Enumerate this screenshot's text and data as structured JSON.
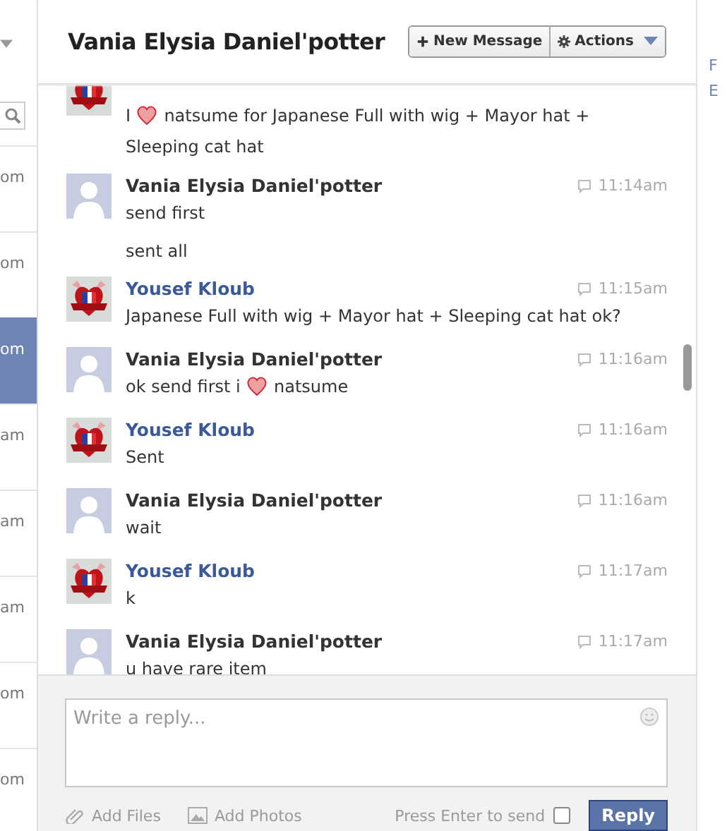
{
  "sidebar": {
    "items": [
      {
        "label": "om",
        "selected": false
      },
      {
        "label": "om",
        "selected": false
      },
      {
        "label": "om",
        "selected": true
      },
      {
        "label": "am",
        "selected": false
      },
      {
        "label": "am",
        "selected": false
      },
      {
        "label": "am",
        "selected": false
      },
      {
        "label": "om",
        "selected": false
      },
      {
        "label": "om",
        "selected": false
      }
    ]
  },
  "header": {
    "title": "Vania Elysia Daniel'potter",
    "buttons": [
      {
        "kind": "new",
        "label": "New Message"
      },
      {
        "kind": "actions",
        "label": "Actions"
      }
    ]
  },
  "messages": [
    {
      "kind": "me",
      "partial": true,
      "lines": [
        [
          {
            "kind": "text",
            "text": "I"
          },
          {
            "kind": "heart"
          },
          {
            "kind": "text",
            "text": "natsume for Japanese Full with wig + Mayor hat + Sleeping cat hat"
          }
        ]
      ]
    },
    {
      "kind": "them",
      "sender": "Vania Elysia Daniel'potter",
      "time": "11:14am",
      "lines": [
        [
          {
            "kind": "text",
            "text": "send first"
          }
        ],
        [
          {
            "kind": "text",
            "text": "sent all"
          }
        ]
      ]
    },
    {
      "kind": "me",
      "sender": "Yousef Kloub",
      "time": "11:15am",
      "lines": [
        [
          {
            "kind": "text",
            "text": "Japanese Full with wig + Mayor hat + Sleeping cat hat ok?"
          }
        ]
      ]
    },
    {
      "kind": "them",
      "sender": "Vania Elysia Daniel'potter",
      "time": "11:16am",
      "lines": [
        [
          {
            "kind": "text",
            "text": "ok send first i"
          },
          {
            "kind": "heart"
          },
          {
            "kind": "text",
            "text": "natsume"
          }
        ]
      ]
    },
    {
      "kind": "me",
      "sender": "Yousef Kloub",
      "time": "11:16am",
      "lines": [
        [
          {
            "kind": "text",
            "text": "Sent"
          }
        ]
      ]
    },
    {
      "kind": "them",
      "sender": "Vania Elysia Daniel'potter",
      "time": "11:16am",
      "lines": [
        [
          {
            "kind": "text",
            "text": "wait"
          }
        ]
      ]
    },
    {
      "kind": "me",
      "sender": "Yousef Kloub",
      "time": "11:17am",
      "lines": [
        [
          {
            "kind": "text",
            "text": "k"
          }
        ]
      ]
    },
    {
      "kind": "them",
      "sender": "Vania Elysia Daniel'potter",
      "time": "11:17am",
      "lines": [
        [
          {
            "kind": "text",
            "text": "u have rare item"
          }
        ]
      ]
    }
  ],
  "composer": {
    "placeholder": "Write a reply...",
    "add_files": "Add Files",
    "add_photos": "Add Photos",
    "enter_label": "Press Enter to send",
    "enter_checked": false,
    "reply": "Reply"
  },
  "right_panel": {
    "lines": [
      "F",
      "E"
    ]
  }
}
